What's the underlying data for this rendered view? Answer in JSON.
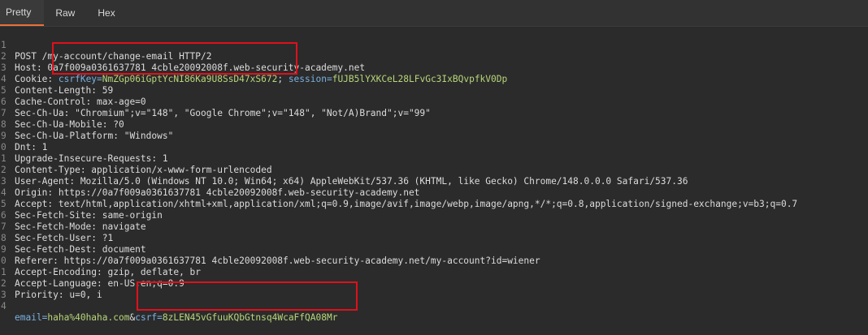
{
  "tabs": [
    {
      "label": "Pretty"
    },
    {
      "label": "Raw"
    },
    {
      "label": "Hex"
    }
  ],
  "request": {
    "line1": "POST /my-account/change-email HTTP/2",
    "line2": "Host: 0a7f009a0361637781 4cble20092008f.web-security-academy.net",
    "line3": {
      "prefix": "Cookie: ",
      "csrf_key_name": "csrfKey=",
      "csrf_key_value": "NmZGp06iGptYcNI86Ka9U8SsD47xS672",
      "sep": "; ",
      "session_name": "session=",
      "session_value": "fUJB5lYXKCeL28LFvGc3IxBQvpfkV0Dp"
    },
    "line4": "Content-Length: 59",
    "line5": "Cache-Control: max-age=0",
    "line6": "Sec-Ch-Ua: \"Chromium\";v=\"148\", \"Google Chrome\";v=\"148\", \"Not/A)Brand\";v=\"99\"",
    "line7": "Sec-Ch-Ua-Mobile: ?0",
    "line8": "Sec-Ch-Ua-Platform: \"Windows\"",
    "line9": "Dnt: 1",
    "line10": "Upgrade-Insecure-Requests: 1",
    "line11": "Content-Type: application/x-www-form-urlencoded",
    "line12": "User-Agent: Mozilla/5.0 (Windows NT 10.0; Win64; x64) AppleWebKit/537.36 (KHTML, like Gecko) Chrome/148.0.0.0 Safari/537.36",
    "line13": "Origin: https://0a7f009a0361637781 4cble20092008f.web-security-academy.net",
    "line14": "Accept: text/html,application/xhtml+xml,application/xml;q=0.9,image/avif,image/webp,image/apng,*/*;q=0.8,application/signed-exchange;v=b3;q=0.7",
    "line15": "Sec-Fetch-Site: same-origin",
    "line16": "Sec-Fetch-Mode: navigate",
    "line17": "Sec-Fetch-User: ?1",
    "line18": "Sec-Fetch-Dest: document",
    "line19": "Referer: https://0a7f009a0361637781 4cble20092008f.web-security-academy.net/my-account?id=wiener",
    "line20": "Accept-Encoding: gzip, deflate, br",
    "line21": "Accept-Language: en-US,en;q=0.9",
    "line22": "Priority: u=0, i",
    "line23": "",
    "line24": {
      "email_name": "email=",
      "email_value": "haha%40haha.com",
      "amp": "&",
      "csrf_name": "csrf=",
      "csrf_value": "8zLEN45vGfuuKQbGtnsq4WcaFfQA08Mr"
    }
  },
  "line_numbers": [
    "1",
    "2",
    "3",
    "4",
    "5",
    "6",
    "7",
    "8",
    "9",
    "0",
    "1",
    "2",
    "3",
    "4",
    "5",
    "6",
    "7",
    "8",
    "9",
    "0",
    "1",
    "2",
    "3",
    "4"
  ],
  "colors": {
    "highlight_box": "#e0101c",
    "cookie_value": "#b8d67a",
    "param_name": "#7ab0e0",
    "active_tab_accent": "#e8713a"
  }
}
